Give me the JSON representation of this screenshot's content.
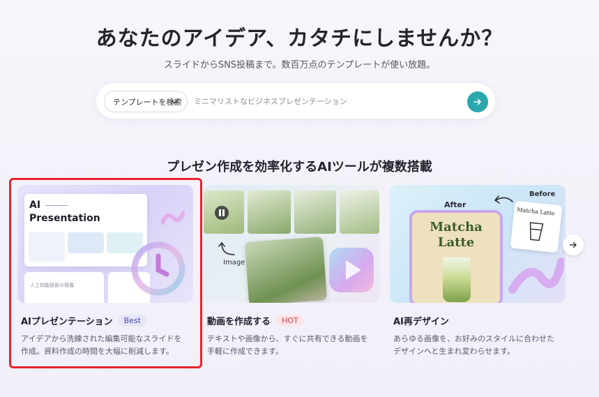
{
  "hero": {
    "title": "あなたのアイデア、カタチにしませんか？",
    "subtitle": "スライドからSNS投稿まで。数百万点のテンプレートが使い放題。"
  },
  "search": {
    "select_label": "テンプレートを検索",
    "placeholder": "ミニマリストなビジネスプレゼンテーション"
  },
  "section": {
    "title": "プレゼン作成を効率化するAIツールが複数搭載"
  },
  "cards": [
    {
      "title": "AIプレゼンテーション",
      "badge": "Best",
      "description": "アイデアから洗練された編集可能なスライドを作成。資料作成の時間を大幅に削減します。",
      "thumb": {
        "heading_line1": "AI",
        "heading_line2": "Presentation",
        "mini_text_1": "人工知能技術の発展"
      }
    },
    {
      "title": "動画を作成する",
      "badge": "HOT",
      "description": "テキストや画像から、すぐに共有できる動画を手軽に作成できます。",
      "thumb": {
        "label": "Image"
      }
    },
    {
      "title": "AI再デザイン",
      "badge": "",
      "description": "あらゆる画像を、お好みのスタイルに合わせたデザインへと生まれ変わらせます。",
      "thumb": {
        "after_label": "After",
        "before_label": "Before",
        "main_text_line1": "Matcha",
        "main_text_line2": "Latte",
        "before_text": "Matcha Latte"
      }
    }
  ],
  "colors": {
    "accent": "#2aa8ad",
    "highlight_border": "#e8242b",
    "badge_best_bg": "#e6e6f6",
    "badge_hot_bg": "#fde6e8"
  },
  "icons": {
    "select_chevron": "chevron-down-icon",
    "search_go": "arrow-right-icon",
    "carousel_next": "arrow-right-icon",
    "video_pause": "pause-icon",
    "video_play": "play-icon"
  }
}
